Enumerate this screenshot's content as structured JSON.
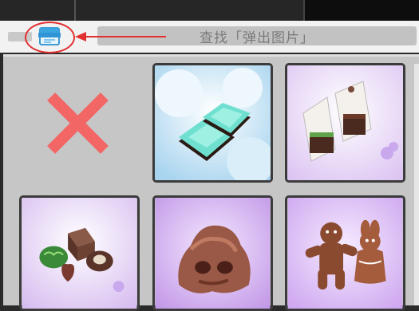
{
  "header": {
    "search_text": "查找「弹出图片」"
  },
  "colors": {
    "highlight_red": "#e03030",
    "close_red": "#f26666",
    "panel_bg": "#c6c6c6",
    "cell_border": "#3b3b3b"
  },
  "icons": {
    "popup": "popup-window-icon",
    "close": "close-x-icon",
    "arrow": "red-arrow-left"
  },
  "grid": {
    "items": [
      {
        "name": "close-item"
      },
      {
        "name": "mint-chocolate-squares"
      },
      {
        "name": "wrapped-brownies"
      },
      {
        "name": "assorted-chocolates"
      },
      {
        "name": "chocolate-blob"
      },
      {
        "name": "gingerbread-cookies"
      }
    ]
  }
}
